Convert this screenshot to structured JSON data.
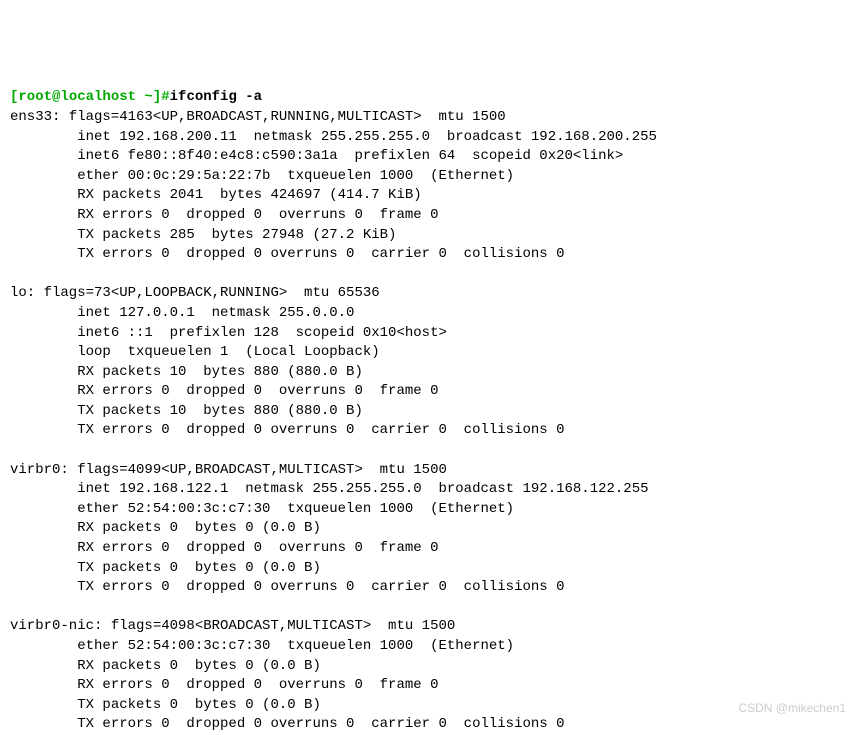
{
  "prompt": {
    "bracket_open": "[",
    "user_host": "root@localhost ~",
    "bracket_close": "]",
    "hash": "#"
  },
  "command": "ifconfig -a",
  "interfaces": {
    "ens33": {
      "header": "ens33: flags=4163<UP,BROADCAST,RUNNING,MULTICAST>  mtu 1500",
      "inet": "        inet 192.168.200.11  netmask 255.255.255.0  broadcast 192.168.200.255",
      "inet6": "        inet6 fe80::8f40:e4c8:c590:3a1a  prefixlen 64  scopeid 0x20<link>",
      "ether": "        ether 00:0c:29:5a:22:7b  txqueuelen 1000  (Ethernet)",
      "rx_packets": "        RX packets 2041  bytes 424697 (414.7 KiB)",
      "rx_errors": "        RX errors 0  dropped 0  overruns 0  frame 0",
      "tx_packets": "        TX packets 285  bytes 27948 (27.2 KiB)",
      "tx_errors": "        TX errors 0  dropped 0 overruns 0  carrier 0  collisions 0"
    },
    "lo": {
      "header": "lo: flags=73<UP,LOOPBACK,RUNNING>  mtu 65536",
      "inet": "        inet 127.0.0.1  netmask 255.0.0.0",
      "inet6": "        inet6 ::1  prefixlen 128  scopeid 0x10<host>",
      "loop": "        loop  txqueuelen 1  (Local Loopback)",
      "rx_packets": "        RX packets 10  bytes 880 (880.0 B)",
      "rx_errors": "        RX errors 0  dropped 0  overruns 0  frame 0",
      "tx_packets": "        TX packets 10  bytes 880 (880.0 B)",
      "tx_errors": "        TX errors 0  dropped 0 overruns 0  carrier 0  collisions 0"
    },
    "virbr0": {
      "header": "virbr0: flags=4099<UP,BROADCAST,MULTICAST>  mtu 1500",
      "inet": "        inet 192.168.122.1  netmask 255.255.255.0  broadcast 192.168.122.255",
      "ether": "        ether 52:54:00:3c:c7:30  txqueuelen 1000  (Ethernet)",
      "rx_packets": "        RX packets 0  bytes 0 (0.0 B)",
      "rx_errors": "        RX errors 0  dropped 0  overruns 0  frame 0",
      "tx_packets": "        TX packets 0  bytes 0 (0.0 B)",
      "tx_errors": "        TX errors 0  dropped 0 overruns 0  carrier 0  collisions 0"
    },
    "virbr0nic": {
      "header": "virbr0-nic: flags=4098<BROADCAST,MULTICAST>  mtu 1500",
      "ether": "        ether 52:54:00:3c:c7:30  txqueuelen 1000  (Ethernet)",
      "rx_packets": "        RX packets 0  bytes 0 (0.0 B)",
      "rx_errors": "        RX errors 0  dropped 0  overruns 0  frame 0",
      "tx_packets": "        TX packets 0  bytes 0 (0.0 B)",
      "tx_errors": "        TX errors 0  dropped 0 overruns 0  carrier 0  collisions 0"
    }
  },
  "watermark": "CSDN @mikechen1"
}
